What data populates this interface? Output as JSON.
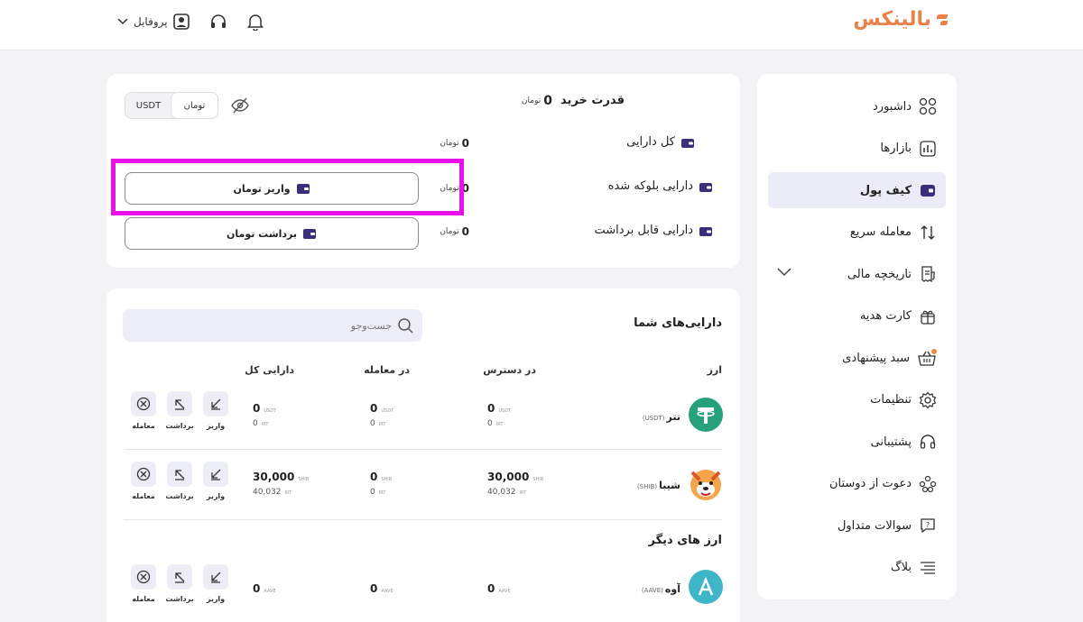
{
  "brand": {
    "logo_text": "بالینکس",
    "accent": "#e8824a"
  },
  "header": {
    "profile_label": "پروفایل",
    "icons": [
      "chevron-down-icon",
      "user-icon",
      "headphones-icon",
      "bell-icon"
    ]
  },
  "sidebar": {
    "items": [
      {
        "label": "داشبورد",
        "icon": "dashboard-icon"
      },
      {
        "label": "بازارها",
        "icon": "chart-icon"
      },
      {
        "label": "کیف پول",
        "icon": "wallet-icon",
        "active": true
      },
      {
        "label": "معامله سریع",
        "icon": "swap-icon"
      },
      {
        "label": "تاریخچه مالی",
        "icon": "receipt-icon"
      },
      {
        "label": "کارت هدیه",
        "icon": "gift-icon"
      },
      {
        "label": "سبد پیشنهادی",
        "icon": "basket-icon"
      },
      {
        "label": "تنظیمات",
        "icon": "gear-icon"
      },
      {
        "label": "پشتیبانی",
        "icon": "headphones-icon"
      },
      {
        "label": "دعوت از دوستان",
        "icon": "users-icon"
      },
      {
        "label": "سوالات متداول",
        "icon": "question-icon"
      },
      {
        "label": "بلاگ",
        "icon": "blog-icon"
      }
    ]
  },
  "balance": {
    "purchase_power_label": "قدرت خرید",
    "purchase_power_value": "0",
    "currency_symbol": "تومان",
    "toggle": {
      "toman": "تومان",
      "usdt": "USDT"
    },
    "rows": [
      {
        "label": "کل دارایی",
        "value": "0"
      },
      {
        "label": "دارایی بلوکه شده",
        "value": "0"
      },
      {
        "label": "دارایی قابل برداشت",
        "value": "0"
      }
    ],
    "deposit_button": "واریز تومان",
    "withdraw_button": "برداشت تومان"
  },
  "assets": {
    "title": "دارایی‌های شما",
    "search_placeholder": "جست‌وجو",
    "columns": {
      "currency": "ارز",
      "available": "در دسترس",
      "in_trade": "در معامله",
      "total": "دارایی کل"
    },
    "actions": {
      "deposit": "واریز",
      "withdraw": "برداشت",
      "trade": "معامله"
    },
    "rows": [
      {
        "name": "تتر",
        "symbol": "(USDT)",
        "unit": "USDT",
        "available": "0",
        "available_irt": "0",
        "in_trade": "0",
        "in_trade_irt": "0",
        "total": "0",
        "total_irt": "0",
        "irt_unit": "IRT"
      },
      {
        "name": "شیبا",
        "symbol": "(SHIB)",
        "unit": "SHIB",
        "available": "30,000",
        "available_irt": "40,032",
        "in_trade": "0",
        "in_trade_irt": "0",
        "total": "30,000",
        "total_irt": "40,032",
        "irt_unit": "IRT"
      }
    ],
    "other_title": "ارز های دیگر",
    "other_rows": [
      {
        "name": "آوه",
        "symbol": "(AAVE)",
        "unit": "AAVE",
        "available": "0",
        "in_trade": "0",
        "total": "0"
      }
    ]
  }
}
